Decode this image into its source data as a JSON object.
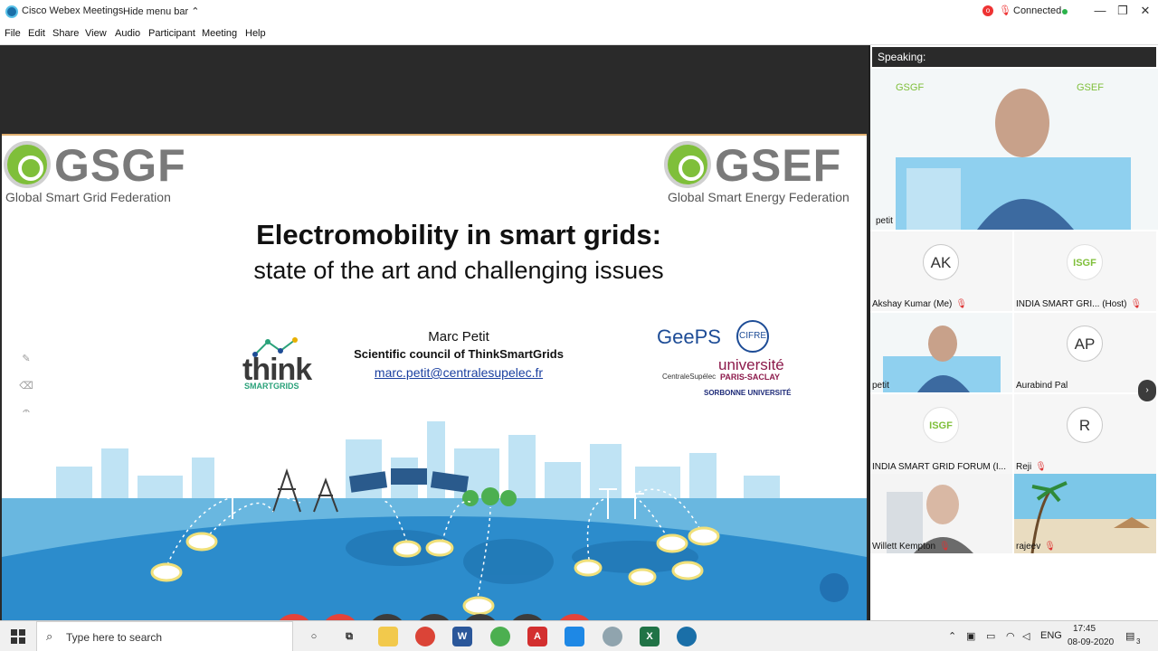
{
  "titlebar": {
    "app_title": "Cisco Webex Meetings",
    "hide_menu_label": "Hide menu bar",
    "connection_status": "Connected",
    "minimize_icon": "minimize-icon",
    "maximize_icon": "maximize-icon",
    "close_icon": "close-icon"
  },
  "menubar": {
    "items": [
      "File",
      "Edit",
      "Share",
      "View",
      "Audio",
      "Participant",
      "Meeting",
      "Help"
    ]
  },
  "slide": {
    "left_logo_text": "GSGF",
    "left_logo_sub": "Global Smart Grid Federation",
    "right_logo_text": "GSEF",
    "right_logo_sub": "Global Smart Energy Federation",
    "title_line1": "Electromobility in smart grids:",
    "title_line2": "state of the art and challenging issues",
    "presenter": "Marc Petit",
    "council": "Scientific council of ThinkSmartGrids",
    "email": "marc.petit@centralesupelec.fr",
    "think_logo": "think",
    "think_logo_sub": "SMARTGRIDS",
    "geeps_logo": "GeePS",
    "cifre_logo": "CIFRE",
    "centrale_logo": "CentraleSupélec",
    "university_logo": "université",
    "university_sub": "PARIS-SACLAY",
    "sorbonne_logo": "SORBONNE UNIVERSITÉ"
  },
  "controls": {
    "mute_icon": "microphone-muted-icon",
    "video_icon": "video-off-icon",
    "share_icon": "share-icon",
    "participants_icon": "participants-icon",
    "chat_icon": "chat-icon",
    "more_label": "···",
    "leave_label": "✕"
  },
  "panel": {
    "speaking_label": "Speaking:",
    "speaker_name": "petit",
    "tiles": [
      {
        "name": "Akshay Kumar  (Me)",
        "initials": "AK",
        "muted": true
      },
      {
        "name": "INDIA SMART GRI... (Host)",
        "logo": "ISGF",
        "muted": true
      },
      {
        "name": "petit",
        "video": true,
        "muted": false
      },
      {
        "name": "Aurabind Pal",
        "initials": "AP",
        "muted": false
      },
      {
        "name": "INDIA SMART GRID FORUM (I...",
        "logo": "ISGF",
        "muted": false
      },
      {
        "name": "Reji",
        "initials": "R",
        "muted": true
      },
      {
        "name": "Willett Kempton",
        "video": true,
        "muted": true
      },
      {
        "name": "rajeev",
        "video": true,
        "muted": true
      }
    ]
  },
  "taskbar": {
    "search_placeholder": "Type here to search",
    "language": "ENG",
    "time": "17:45",
    "date": "08-09-2020",
    "notification_count": "3"
  },
  "colors": {
    "leave_red": "#e4433a",
    "accent_green": "#7fbf3a",
    "sky_blue": "#69b7e0",
    "earth_blue": "#2c8ccc"
  }
}
